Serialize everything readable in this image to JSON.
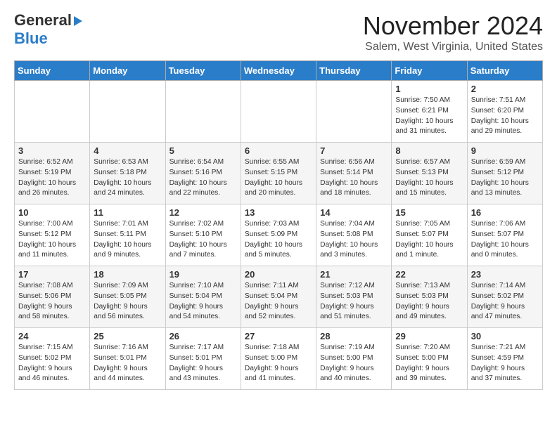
{
  "logo": {
    "general": "General",
    "blue": "Blue",
    "arrow": "▶"
  },
  "header": {
    "month": "November 2024",
    "location": "Salem, West Virginia, United States"
  },
  "weekdays": [
    "Sunday",
    "Monday",
    "Tuesday",
    "Wednesday",
    "Thursday",
    "Friday",
    "Saturday"
  ],
  "weeks": [
    [
      {
        "day": "",
        "info": ""
      },
      {
        "day": "",
        "info": ""
      },
      {
        "day": "",
        "info": ""
      },
      {
        "day": "",
        "info": ""
      },
      {
        "day": "",
        "info": ""
      },
      {
        "day": "1",
        "info": "Sunrise: 7:50 AM\nSunset: 6:21 PM\nDaylight: 10 hours\nand 31 minutes."
      },
      {
        "day": "2",
        "info": "Sunrise: 7:51 AM\nSunset: 6:20 PM\nDaylight: 10 hours\nand 29 minutes."
      }
    ],
    [
      {
        "day": "3",
        "info": "Sunrise: 6:52 AM\nSunset: 5:19 PM\nDaylight: 10 hours\nand 26 minutes."
      },
      {
        "day": "4",
        "info": "Sunrise: 6:53 AM\nSunset: 5:18 PM\nDaylight: 10 hours\nand 24 minutes."
      },
      {
        "day": "5",
        "info": "Sunrise: 6:54 AM\nSunset: 5:16 PM\nDaylight: 10 hours\nand 22 minutes."
      },
      {
        "day": "6",
        "info": "Sunrise: 6:55 AM\nSunset: 5:15 PM\nDaylight: 10 hours\nand 20 minutes."
      },
      {
        "day": "7",
        "info": "Sunrise: 6:56 AM\nSunset: 5:14 PM\nDaylight: 10 hours\nand 18 minutes."
      },
      {
        "day": "8",
        "info": "Sunrise: 6:57 AM\nSunset: 5:13 PM\nDaylight: 10 hours\nand 15 minutes."
      },
      {
        "day": "9",
        "info": "Sunrise: 6:59 AM\nSunset: 5:12 PM\nDaylight: 10 hours\nand 13 minutes."
      }
    ],
    [
      {
        "day": "10",
        "info": "Sunrise: 7:00 AM\nSunset: 5:12 PM\nDaylight: 10 hours\nand 11 minutes."
      },
      {
        "day": "11",
        "info": "Sunrise: 7:01 AM\nSunset: 5:11 PM\nDaylight: 10 hours\nand 9 minutes."
      },
      {
        "day": "12",
        "info": "Sunrise: 7:02 AM\nSunset: 5:10 PM\nDaylight: 10 hours\nand 7 minutes."
      },
      {
        "day": "13",
        "info": "Sunrise: 7:03 AM\nSunset: 5:09 PM\nDaylight: 10 hours\nand 5 minutes."
      },
      {
        "day": "14",
        "info": "Sunrise: 7:04 AM\nSunset: 5:08 PM\nDaylight: 10 hours\nand 3 minutes."
      },
      {
        "day": "15",
        "info": "Sunrise: 7:05 AM\nSunset: 5:07 PM\nDaylight: 10 hours\nand 1 minute."
      },
      {
        "day": "16",
        "info": "Sunrise: 7:06 AM\nSunset: 5:07 PM\nDaylight: 10 hours\nand 0 minutes."
      }
    ],
    [
      {
        "day": "17",
        "info": "Sunrise: 7:08 AM\nSunset: 5:06 PM\nDaylight: 9 hours\nand 58 minutes."
      },
      {
        "day": "18",
        "info": "Sunrise: 7:09 AM\nSunset: 5:05 PM\nDaylight: 9 hours\nand 56 minutes."
      },
      {
        "day": "19",
        "info": "Sunrise: 7:10 AM\nSunset: 5:04 PM\nDaylight: 9 hours\nand 54 minutes."
      },
      {
        "day": "20",
        "info": "Sunrise: 7:11 AM\nSunset: 5:04 PM\nDaylight: 9 hours\nand 52 minutes."
      },
      {
        "day": "21",
        "info": "Sunrise: 7:12 AM\nSunset: 5:03 PM\nDaylight: 9 hours\nand 51 minutes."
      },
      {
        "day": "22",
        "info": "Sunrise: 7:13 AM\nSunset: 5:03 PM\nDaylight: 9 hours\nand 49 minutes."
      },
      {
        "day": "23",
        "info": "Sunrise: 7:14 AM\nSunset: 5:02 PM\nDaylight: 9 hours\nand 47 minutes."
      }
    ],
    [
      {
        "day": "24",
        "info": "Sunrise: 7:15 AM\nSunset: 5:02 PM\nDaylight: 9 hours\nand 46 minutes."
      },
      {
        "day": "25",
        "info": "Sunrise: 7:16 AM\nSunset: 5:01 PM\nDaylight: 9 hours\nand 44 minutes."
      },
      {
        "day": "26",
        "info": "Sunrise: 7:17 AM\nSunset: 5:01 PM\nDaylight: 9 hours\nand 43 minutes."
      },
      {
        "day": "27",
        "info": "Sunrise: 7:18 AM\nSunset: 5:00 PM\nDaylight: 9 hours\nand 41 minutes."
      },
      {
        "day": "28",
        "info": "Sunrise: 7:19 AM\nSunset: 5:00 PM\nDaylight: 9 hours\nand 40 minutes."
      },
      {
        "day": "29",
        "info": "Sunrise: 7:20 AM\nSunset: 5:00 PM\nDaylight: 9 hours\nand 39 minutes."
      },
      {
        "day": "30",
        "info": "Sunrise: 7:21 AM\nSunset: 4:59 PM\nDaylight: 9 hours\nand 37 minutes."
      }
    ]
  ]
}
